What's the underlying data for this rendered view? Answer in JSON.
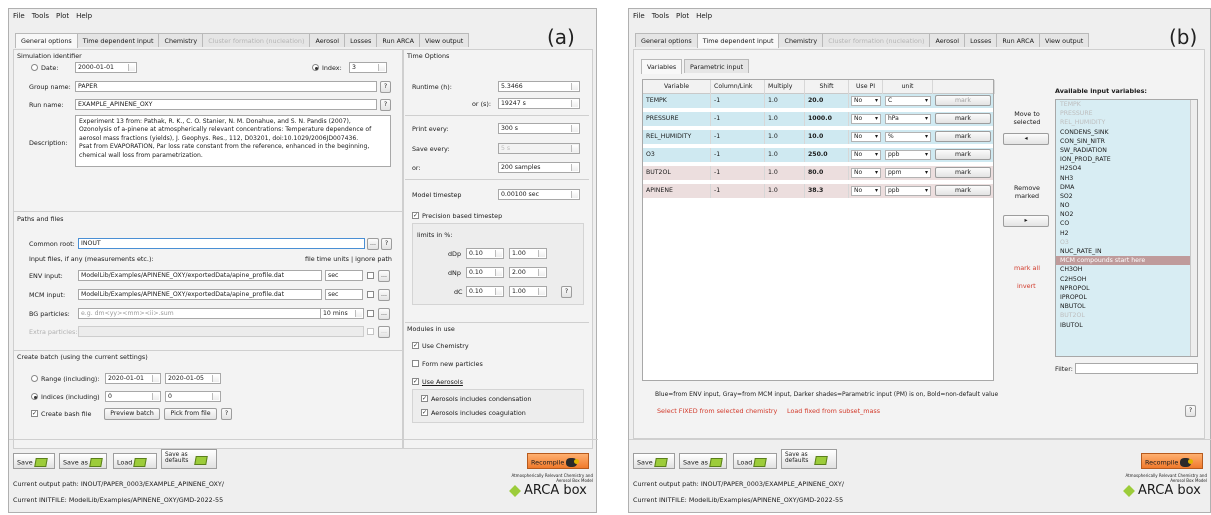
{
  "panel_a": {
    "letter": "(a)"
  },
  "panel_b": {
    "letter": "(b)"
  },
  "menu": [
    "File",
    "Tools",
    "Plot",
    "Help"
  ],
  "tabs": [
    "General options",
    "Time dependent input",
    "Chemistry",
    "Cluster formation (nucleation)",
    "Aerosol",
    "Losses",
    "Run ARCA",
    "View output"
  ],
  "general": {
    "sim_title": "Simulation identifier",
    "date_label": "Date:",
    "date_value": "2000-01-01",
    "index_label": "Index:",
    "index_value": "3",
    "group_label": "Group name:",
    "group_value": "PAPER",
    "run_label": "Run name:",
    "run_value": "EXAMPLE_APINENE_OXY",
    "desc_label": "Description:",
    "desc_lines": [
      "Experiment 13 from: Pathak, R. K., C. O. Stanier, N. M. Donahue, and S. N. Pandis (2007),",
      "Ozonolysis of a-pinene at atmospherically relevant concentrations: Temperature dependence of",
      "aerosol mass fractions (yields), J. Geophys. Res., 112, D03201, doi:10.1029/2006JD007436.",
      "Psat from EVAPORATION, Par loss rate constant from the reference, enhanced in the beginning,",
      "chemical wall loss from parametrization."
    ],
    "q": "?",
    "paths_title": "Paths and files",
    "common_label": "Common root:",
    "common_value": "INOUT",
    "input_files_label": "Input files, if any (measurements etc.):",
    "units_header": "file time units | ignore path",
    "env_label": "ENV input:",
    "env_value": "ModelLib/Examples/APINENE_OXY/exportedData/apine_profile.dat",
    "env_unit": "sec",
    "mcm_label": "MCM input:",
    "mcm_value": "ModelLib/Examples/APINENE_OXY/exportedData/apine_profile.dat",
    "mcm_unit": "sec",
    "bg_label": "BG particles:",
    "bg_placeholder": "e.g. dm<yy><mm><ii>.sum",
    "bg_unit": "10 mins",
    "extra_label": "Extra particles:",
    "dots": "...",
    "batch_title": "Create batch (using the current settings)",
    "range_label": "Range (including):",
    "range_from": "2020-01-01",
    "range_to": "2020-01-05",
    "indices_label": "Indices (including)",
    "idx_from": "0",
    "idx_to": "0",
    "bash_label": "Create bash file",
    "preview_btn": "Preview batch",
    "pick_btn": "Pick from file",
    "time_title": "Time Options",
    "runtime_label": "Runtime (h):",
    "runtime_value": "5.3466",
    "ors_label": "or (s):",
    "ors_value": "19247 s",
    "print_label": "Print every:",
    "print_value": "300 s",
    "saveevery_label": "Save every:",
    "saveevery_value": "5 s",
    "or_label": "or:",
    "or_value": "200 samples",
    "timestep_label": "Model timestep",
    "timestep_value": "0.00100 sec",
    "precision_label": "Precision based timestep",
    "limits_label": "limits in %:",
    "limits": [
      {
        "name": "dDp",
        "a": "0.10",
        "b": "1.00"
      },
      {
        "name": "dNp",
        "a": "0.10",
        "b": "2.00"
      },
      {
        "name": "dC",
        "a": "0.10",
        "b": "1.00"
      }
    ],
    "modules_title": "Modules in use",
    "use_chem": "Use Chemistry",
    "form_new": "Form new particles",
    "use_aer": "Use Aerosols",
    "cond": "Aerosols includes condensation",
    "coag": "Aerosols includes coagulation"
  },
  "footer": {
    "save": "Save",
    "save_as": "Save as",
    "load": "Load",
    "save_defaults": "Save as defaults",
    "recompile": "Recompile",
    "output_path": "Current output path: INOUT/PAPER_0003/EXAMPLE_APINENE_OXY/",
    "initfile": "Current INITFILE: ModelLib/Examples/APINENE_OXY/GMD-2022-55",
    "logo_small": "Atmospherically Relevant Chemistry and Aerosol Box Model",
    "logo_big": "ARCA box"
  },
  "tdi": {
    "subtabs": [
      "Variables",
      "Parametric input"
    ],
    "headers": [
      "Variable",
      "Column/Link",
      "Multiply",
      "Shift",
      "Use PI",
      "unit",
      ""
    ],
    "rows": [
      {
        "var": "TEMPK",
        "col": "-1",
        "mult": "1.0",
        "shift": "20.0",
        "pi": "No",
        "unit": "C",
        "mark": "mark",
        "kind": "env"
      },
      {
        "var": "PRESSURE",
        "col": "-1",
        "mult": "1.0",
        "shift": "1000.0",
        "pi": "No",
        "unit": "hPa",
        "mark": "mark",
        "kind": "env"
      },
      {
        "var": "REL_HUMIDITY",
        "col": "-1",
        "mult": "1.0",
        "shift": "10.0",
        "pi": "No",
        "unit": "%",
        "mark": "mark",
        "kind": "env"
      },
      {
        "var": "O3",
        "col": "-1",
        "mult": "1.0",
        "shift": "250.0",
        "pi": "No",
        "unit": "ppb",
        "mark": "mark",
        "kind": "env"
      },
      {
        "var": "BUT2OL",
        "col": "-1",
        "mult": "1.0",
        "shift": "80.0",
        "pi": "No",
        "unit": "ppm",
        "mark": "mark",
        "kind": "pm"
      },
      {
        "var": "APINENE",
        "col": "-1",
        "mult": "1.0",
        "shift": "38.3",
        "pi": "No",
        "unit": "ppb",
        "mark": "mark",
        "kind": "pm"
      }
    ],
    "move_selected": "Move to selected",
    "remove_marked": "Remove marked",
    "left_arrow": "◂",
    "right_arrow": "▸",
    "mark_all": "mark all",
    "invert": "invert",
    "avail_title": "Available input variables:",
    "avail": [
      {
        "t": "TEMPK",
        "s": "grey"
      },
      {
        "t": "PRESSURE",
        "s": "grey"
      },
      {
        "t": "REL_HUMIDITY",
        "s": "grey"
      },
      {
        "t": "CONDENS_SINK",
        "s": ""
      },
      {
        "t": "CON_SIN_NITR",
        "s": ""
      },
      {
        "t": "SW_RADIATION",
        "s": ""
      },
      {
        "t": "ION_PROD_RATE",
        "s": ""
      },
      {
        "t": "H2SO4",
        "s": ""
      },
      {
        "t": "NH3",
        "s": ""
      },
      {
        "t": "DMA",
        "s": ""
      },
      {
        "t": "SO2",
        "s": ""
      },
      {
        "t": "NO",
        "s": ""
      },
      {
        "t": "NO2",
        "s": ""
      },
      {
        "t": "CO",
        "s": ""
      },
      {
        "t": "H2",
        "s": ""
      },
      {
        "t": "O3",
        "s": "grey"
      },
      {
        "t": "NUC_RATE_IN",
        "s": ""
      },
      {
        "t": "MCM compounds start here",
        "s": "hl"
      },
      {
        "t": "CH3OH",
        "s": ""
      },
      {
        "t": "C2H5OH",
        "s": ""
      },
      {
        "t": "NPROPOL",
        "s": ""
      },
      {
        "t": "IPROPOL",
        "s": ""
      },
      {
        "t": "NBUTOL",
        "s": ""
      },
      {
        "t": "BUT2OL",
        "s": "grey"
      },
      {
        "t": "IBUTOL",
        "s": ""
      }
    ],
    "filter_label": "Filter:",
    "legend": "Blue=from ENV input, Gray=from MCM input, Darker shades=Parametric input (PM) is on, Bold=non-default value",
    "select_fixed": "Select FIXED from selected chemistry",
    "load_fixed": "Load fixed from subset_mass"
  },
  "colors": {
    "env_row": "#cfe9f1",
    "pm_row": "#ecdede",
    "highlight": "#bf9b9b",
    "red": "#d23a2b",
    "recompile": "#f17a2c"
  }
}
